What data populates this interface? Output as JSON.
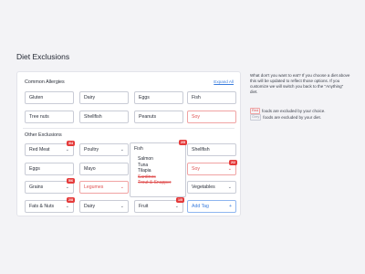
{
  "page": {
    "title": "Diet Exclusions"
  },
  "common": {
    "label": "Common Allergies",
    "expand": "Expand All",
    "tags": [
      {
        "label": "Gluten",
        "state": "normal"
      },
      {
        "label": "Dairy",
        "state": "normal"
      },
      {
        "label": "Eggs",
        "state": "normal"
      },
      {
        "label": "Fish",
        "state": "normal"
      },
      {
        "label": "Tree nuts",
        "state": "normal"
      },
      {
        "label": "Shellfish",
        "state": "normal"
      },
      {
        "label": "Peanuts",
        "state": "normal"
      },
      {
        "label": "Soy",
        "state": "excluded"
      }
    ]
  },
  "other": {
    "label": "Other Exclusions",
    "tags": [
      {
        "label": "Red Meat",
        "badge": "3/4",
        "chevron": true,
        "state": "normal"
      },
      {
        "label": "Poultry",
        "chevron": true,
        "state": "normal"
      },
      {
        "label": "Fish",
        "badge": "2/5",
        "chevron": true,
        "state": "open"
      },
      {
        "label": "Shellfish",
        "state": "normal"
      },
      {
        "label": "Eggs",
        "state": "normal"
      },
      {
        "label": "Mayo",
        "state": "normal"
      },
      {
        "label": "Soy",
        "badge": "2/2",
        "chevron": true,
        "state": "excluded"
      },
      {
        "label": "Grains",
        "badge": "5/6",
        "chevron": true,
        "state": "normal"
      },
      {
        "label": "Legumes",
        "chevron": true,
        "state": "excluded"
      },
      {
        "label": "Vegetables",
        "chevron": true,
        "state": "normal"
      },
      {
        "label": "Fats & Nuts",
        "badge": "2/8",
        "chevron": true,
        "state": "normal"
      },
      {
        "label": "Dairy",
        "chevron": true,
        "state": "normal"
      },
      {
        "label": "Fruit",
        "badge": "1/5",
        "chevron": true,
        "state": "normal"
      }
    ],
    "add_tag": "Add Tag",
    "add_icon": "+"
  },
  "dropdown": {
    "header": "Fish",
    "badge": "2/5",
    "items": [
      {
        "label": "Salmon",
        "excluded": false
      },
      {
        "label": "Tuna",
        "excluded": false
      },
      {
        "label": "Tilapia",
        "excluded": false
      },
      {
        "label": "Sardines",
        "excluded": true
      },
      {
        "label": "Trout & Snapper",
        "excluded": true
      }
    ]
  },
  "side": {
    "text": "What don't you want to eat? If you choose a diet above this will be updated to reflect those options. If you customize we will switch you back to the \"Anything\" diet.",
    "legend_red_chip": "Red",
    "legend_red": "foods are excluded by your choice.",
    "legend_grey_chip": "Grey",
    "legend_grey": "foods are excluded by your diet."
  },
  "colors": {
    "accent": "#3b7ddd",
    "excluded": "#e05252",
    "badge": "#e53b3b"
  },
  "icons": {
    "chevron": "chevron-down-icon",
    "add": "plus-icon"
  }
}
